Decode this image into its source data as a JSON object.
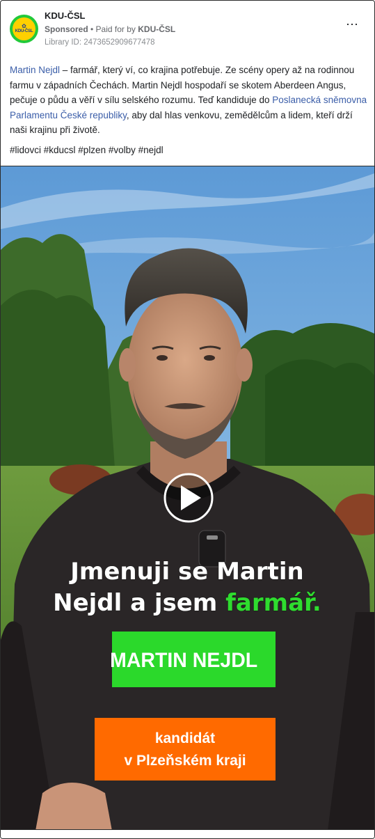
{
  "advertiser": {
    "name": "KDU-ČSL",
    "avatar_text": "KDU-ČSL",
    "sponsored_label": "Sponsored",
    "separator": " • ",
    "paid_for_prefix": "Paid for by ",
    "payer": "KDU-ČSL",
    "library_id": "Library ID: 2473652909677478"
  },
  "menu": {
    "more_icon": "⋯",
    "icon_name": "more-options-icon"
  },
  "post": {
    "link_1": "Martin Nejdl",
    "text_1": " – farmář, který ví, co krajina potřebuje. Ze scény opery až na rodinnou farmu v západních Čechách. Martin Nejdl hospodaří se skotem Aberdeen Angus, pečuje o půdu a věří v sílu selského rozumu. Teď kandiduje do ",
    "link_2": "Poslanecká sněmovna Parlamentu České republiky",
    "text_2": ", aby dal hlas venkovu, zemědělcům a lidem, kteří drží naši krajinu při životě.",
    "hashtags": "#lidovci #kducsl #plzen #volby #nejdl"
  },
  "video": {
    "caption_line_1": "Jmenuji se Martin",
    "caption_line_2_prefix": "Nejdl a jsem ",
    "caption_highlight": "farmář.",
    "name_banner": "MARTIN NEJDL",
    "role_line_1": "kandidát",
    "role_line_2": "v Plzeňském kraji",
    "play_icon": "play-icon"
  },
  "colors": {
    "brand_green": "#22c93a",
    "brand_yellow": "#ffd000",
    "link_blue": "#3a5da8",
    "banner_green": "#2bd92b",
    "banner_orange": "#ff6a00",
    "caption_highlight": "#2fdc2f"
  }
}
